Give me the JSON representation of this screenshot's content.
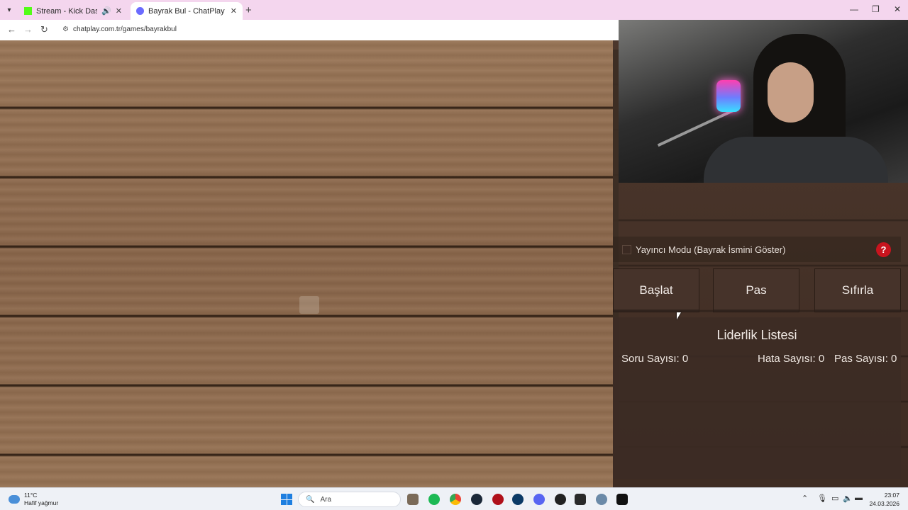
{
  "browser": {
    "tabs": [
      {
        "title": "Stream - Kick Dashboard",
        "favicon_color": "#53fc18",
        "audio": true
      },
      {
        "title": "Bayrak Bul - ChatPlay",
        "favicon_color": "#6b6bff"
      }
    ],
    "url": "chatplay.com.tr/games/bayrakbul"
  },
  "game": {
    "streamer_mode_label": "Yayıncı Modu (Bayrak İsmini Göster)",
    "help_label": "?",
    "buttons": {
      "start": "Başlat",
      "pass": "Pas",
      "reset": "Sıfırla"
    },
    "leaderboard": {
      "title": "Liderlik Listesi",
      "question_count": "Soru Sayısı: 0",
      "error_count": "Hata Sayısı: 0",
      "pass_count": "Pas Sayısı: 0"
    }
  },
  "taskbar": {
    "weather_temp": "11°C",
    "weather_desc": "Hafif yağmur",
    "search_placeholder": "Ara",
    "time": "23:07",
    "date": "24.03.2026"
  },
  "colors": {
    "help_red": "#c8141e",
    "windows_blue": "#1e7fe0"
  }
}
